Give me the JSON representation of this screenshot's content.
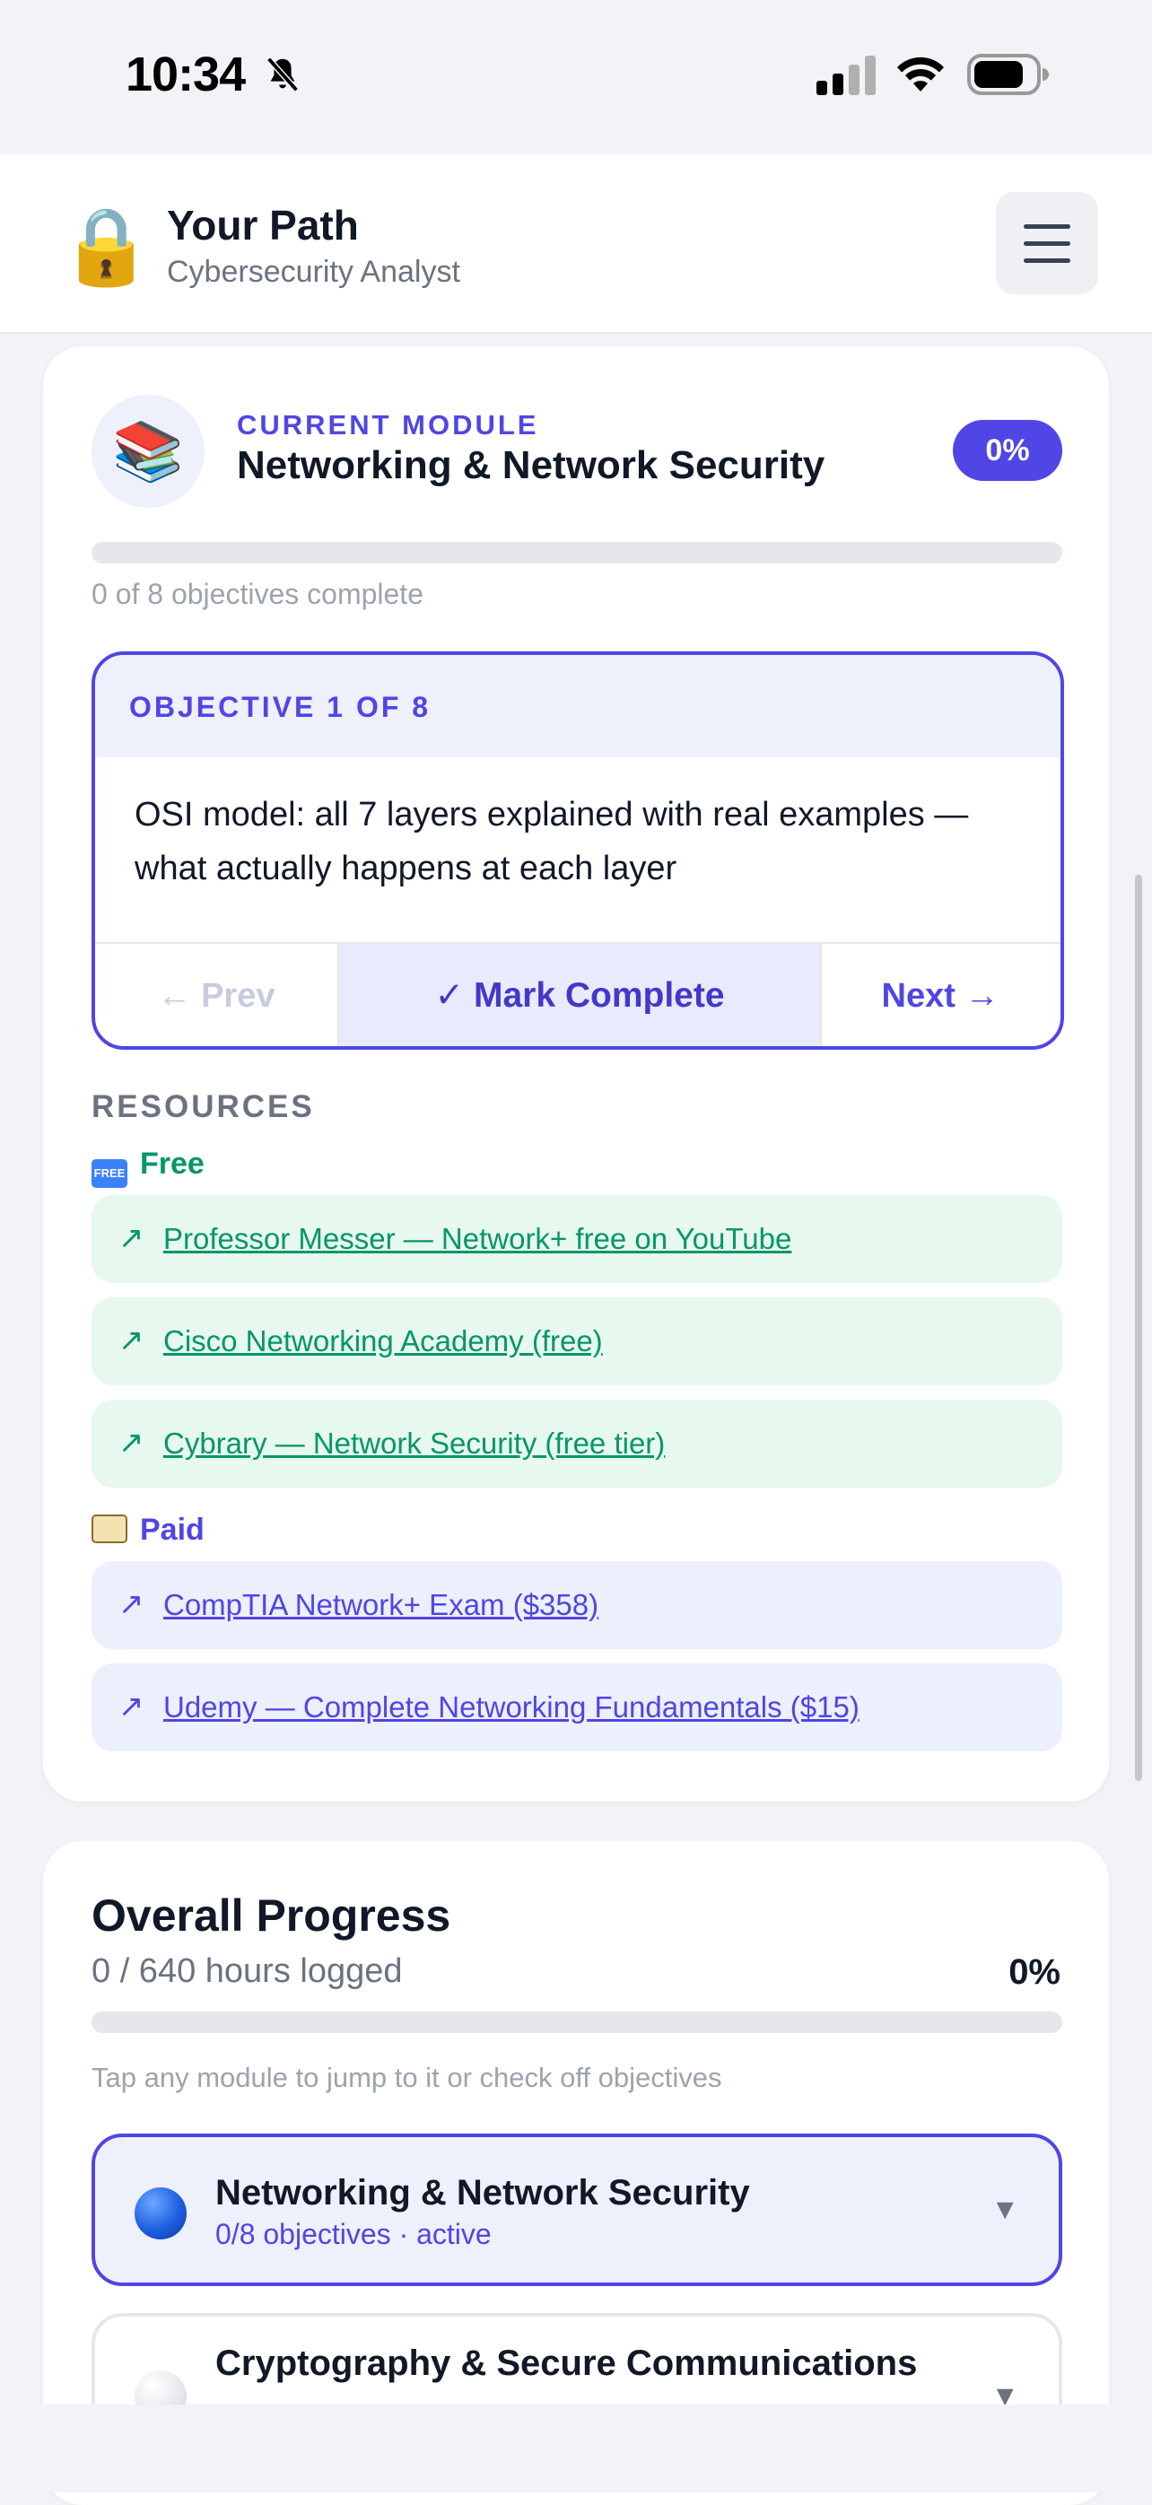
{
  "status_bar": {
    "time": "10:34",
    "icons": [
      "bell-slash-icon",
      "signal-icon",
      "wifi-icon",
      "battery-icon"
    ]
  },
  "header": {
    "logo": "🔒",
    "title": "Your Path",
    "subtitle": "Cybersecurity Analyst",
    "menu_icon": "hamburger-menu-icon"
  },
  "current_module": {
    "icon": "📚",
    "label": "CURRENT MODULE",
    "title": "Networking & Network Security",
    "percent": "0%",
    "progress": 0,
    "objectives_text": "0 of 8 objectives complete",
    "objective": {
      "header": "OBJECTIVE 1 OF 8",
      "text": "OSI model: all 7 layers explained with real examples — what actually happens at each layer",
      "prev_label": "← Prev",
      "complete_label": "✓ Mark Complete",
      "next_label": "Next →"
    },
    "resources": {
      "title": "RESOURCES",
      "free_label": "Free",
      "free_icon": "🆓",
      "free": [
        "Professor Messer — Network+ free on YouTube",
        "Cisco Networking Academy (free)",
        "Cybrary — Network Security (free tier)"
      ],
      "paid_label": "Paid",
      "paid_icon": "💳",
      "paid": [
        "CompTIA Network+ Exam ($358)",
        "Udemy — Complete Networking Fundamentals ($15)"
      ],
      "link_arrow": "↗"
    }
  },
  "overall": {
    "title": "Overall Progress",
    "hours": "0 / 640 hours logged",
    "percent": "0%",
    "progress": 0,
    "hint": "Tap any module to jump to it or check off objectives",
    "modules": [
      {
        "name": "Networking & Network Security",
        "meta": "0/8 objectives · active",
        "state": "active"
      },
      {
        "name": "Cryptography & Secure Communications",
        "meta": "",
        "state": "idle"
      }
    ],
    "chevron": "▼"
  },
  "colors": {
    "accent": "#4f46e5",
    "free": "#059669",
    "background": "#f2f3f7"
  }
}
